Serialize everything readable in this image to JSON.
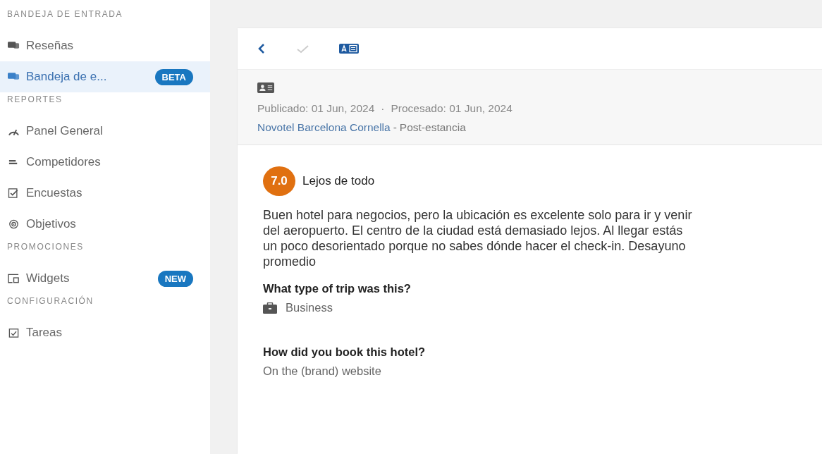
{
  "sidebar": {
    "sections": [
      {
        "heading": "BANDEJA DE ENTRADA",
        "items": [
          {
            "label": "Reseñas",
            "selected": false
          },
          {
            "label": "Bandeja de e...",
            "selected": true,
            "badge": "BETA"
          }
        ]
      },
      {
        "heading": "REPORTES",
        "items": [
          {
            "label": "Panel General",
            "selected": false
          },
          {
            "label": "Competidores",
            "selected": false
          },
          {
            "label": "Encuestas",
            "selected": false
          },
          {
            "label": "Objetivos",
            "selected": false
          }
        ]
      },
      {
        "heading": "PROMOCIONES",
        "items": [
          {
            "label": "Widgets",
            "selected": false,
            "badge": "NEW"
          }
        ]
      },
      {
        "heading": "CONFIGURACIÓN",
        "items": [
          {
            "label": "Tareas",
            "selected": false
          }
        ]
      }
    ]
  },
  "review": {
    "published": "Publicado: 01 Jun, 2024",
    "date_separator": "·",
    "processed": "Procesado: 01 Jun, 2024",
    "hotel": "Novotel Barcelona Cornella",
    "source_separator": "-",
    "stage": "Post-estancia",
    "score": "7.0",
    "title": "Lejos de todo",
    "text": "Buen hotel para negocios, pero la ubicación es excelente solo para ir y venir del aeropuerto. El centro de la ciudad está demasiado lejos. Al llegar estás un poco desorientado porque no sabes dónde hacer el check-in. Desayuno promedio",
    "questions": [
      {
        "question": "What type of trip was this?",
        "answer": "Business",
        "kind": "icon"
      },
      {
        "question": "How did you book this hotel?",
        "answer": "On the (brand) website",
        "kind": "plain"
      }
    ]
  }
}
